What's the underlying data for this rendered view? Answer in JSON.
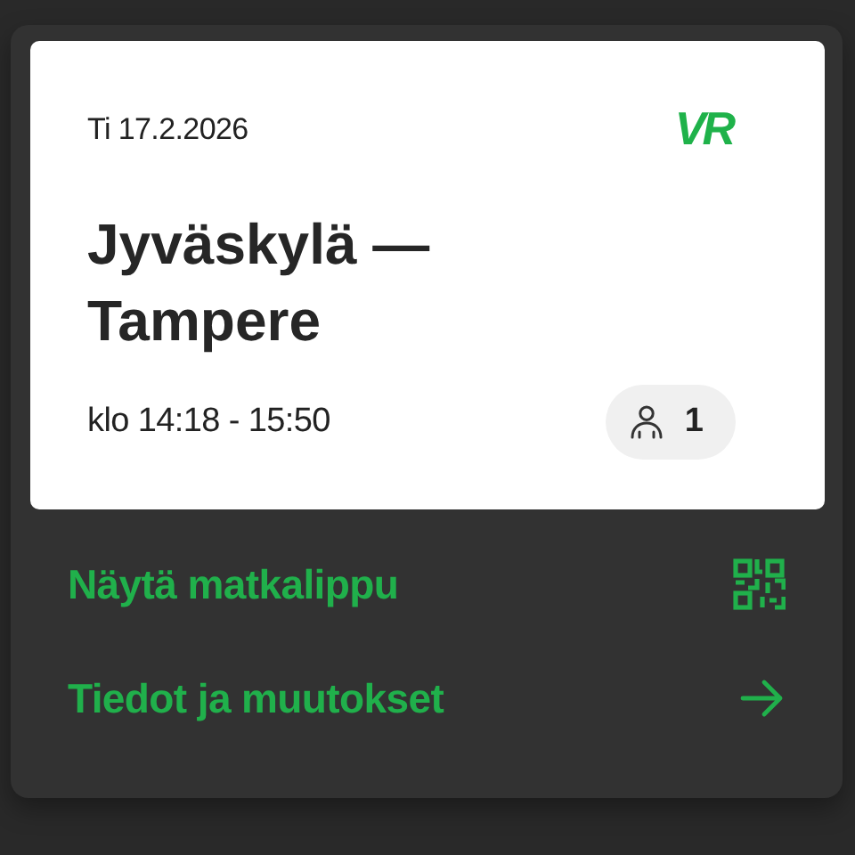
{
  "trip": {
    "date": "Ti 17.2.2026",
    "logo": "VR",
    "route": "Jyväskylä —\nTampere",
    "time": "klo 14:18 - 15:50",
    "passengers": "1"
  },
  "actions": [
    {
      "label": "Näytä matkalippu",
      "kind": "qr"
    },
    {
      "label": "Tiedot ja muutokset",
      "kind": "arrow"
    }
  ]
}
